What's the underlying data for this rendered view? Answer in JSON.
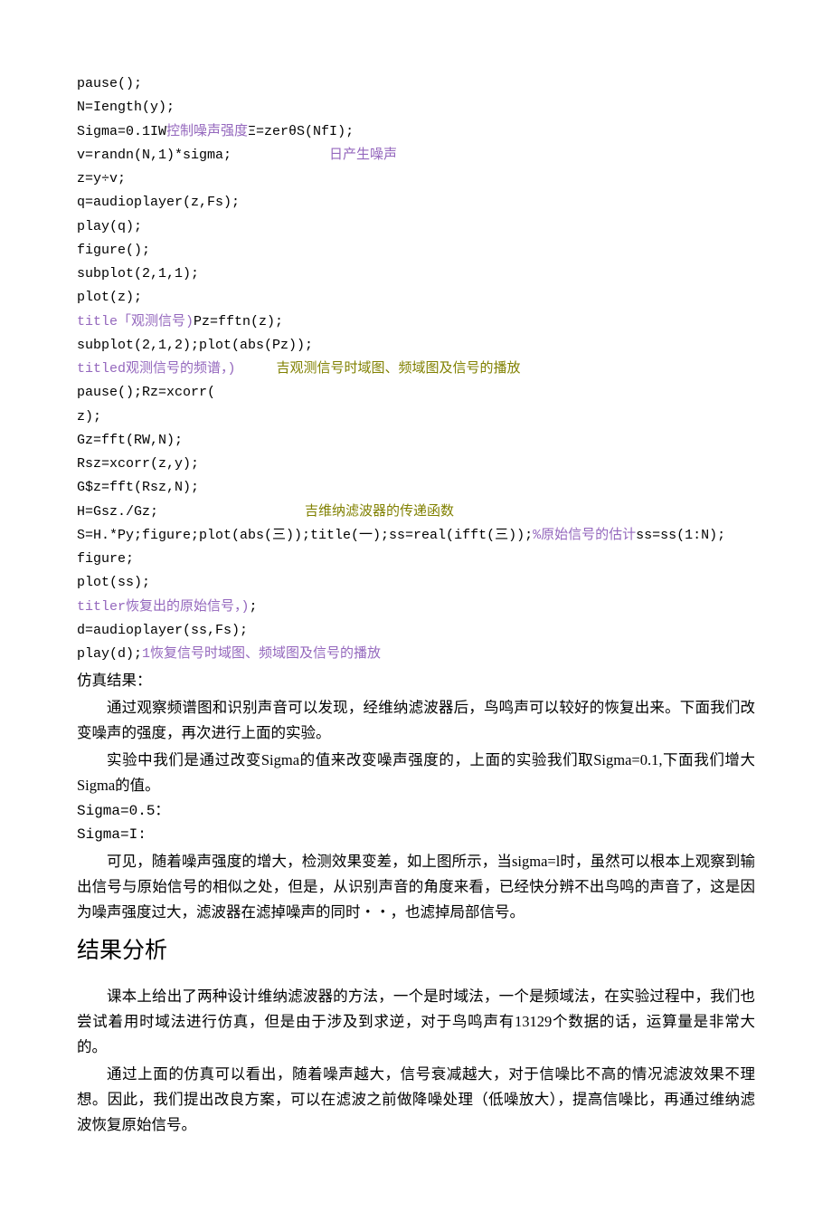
{
  "code": {
    "l1": "pause();",
    "l2": "N=Iength(y);",
    "l3a": "Sigma=0.1IW",
    "l3b": "控制噪声强度",
    "l3c": "Ξ=zerθS(NfI);",
    "l4a": "v=randn(N,1)*sigma;            ",
    "l4b": "日产生噪声",
    "l5": "z=y÷v;",
    "l6": "q=audioplayer(z,Fs);",
    "l7": "play(q);",
    "l8": "figure();",
    "l9": "subplot(2,1,1);",
    "l10": "plot(z);",
    "l11a": "title「观测信号)",
    "l11b": "Pz=fftn(z);",
    "l12": "subplot(2,1,2);plot(abs(Pz));",
    "l13a": "titled观测信号的频谱，)     ",
    "l13b": "吉观测信号时域图、频域图及信号的播放",
    "l14": "pause();Rz=xcorr(",
    "l15": "z);",
    "l16": "Gz=fft(RW,N);",
    "l17": "Rsz=xcorr(z,y);",
    "l18": "G$z=fft(Rsz,N);",
    "l19a": "H=Gsz./Gz;                  ",
    "l19b": "吉维纳滤波器的传递函数",
    "l20a": "S=H.*Py;figure;plot(abs(三));title(一);ss=real(ifft(三));",
    "l20b": "%原始信号的估计",
    "l20c": "ss=ss(1:N);",
    "l21": "figure;",
    "l22": "plot(ss);",
    "l23a": "titler恢复出的原始信号，)",
    "l23b": ";",
    "l24": "d=audioplayer(ss,Fs);",
    "l25a": "play(d);",
    "l25b": "1恢复信号时域图、频域图及信号的播放"
  },
  "text": {
    "sim_label": "仿真结果：",
    "p1": "通过观察频谱图和识别声音可以发现，经维纳滤波器后，鸟鸣声可以较好的恢复出来。下面我们改变噪声的强度，再次进行上面的实验。",
    "p2": "实验中我们是通过改变Sigma的值来改变噪声强度的，上面的实验我们取Sigma=0.1,下面我们增大Sigma的值。",
    "sigma05": "Sigma=0.5：",
    "sigmaI": "Sigma=I:",
    "p3": "可见，随着噪声强度的增大，检测效果变差，如上图所示，当sigma=l时，虽然可以根本上观察到输出信号与原始信号的相似之处，但是，从识别声音的角度来看，已经快分辨不出鸟鸣的声音了，这是因为噪声强度过大，滤波器在滤掉噪声的同时・・，也滤掉局部信号。",
    "section": "结果分析",
    "p4": "课本上给出了两种设计维纳滤波器的方法，一个是时域法，一个是频域法，在实验过程中，我们也尝试着用时域法进行仿真，但是由于涉及到求逆，对于鸟鸣声有13129个数据的话，运算量是非常大的。",
    "p5": "通过上面的仿真可以看出，随着噪声越大，信号衰减越大，对于信噪比不高的情况滤波效果不理想。因此，我们提出改良方案，可以在滤波之前做降噪处理（低噪放大），提高信噪比，再通过维纳滤波恢复原始信号。"
  }
}
